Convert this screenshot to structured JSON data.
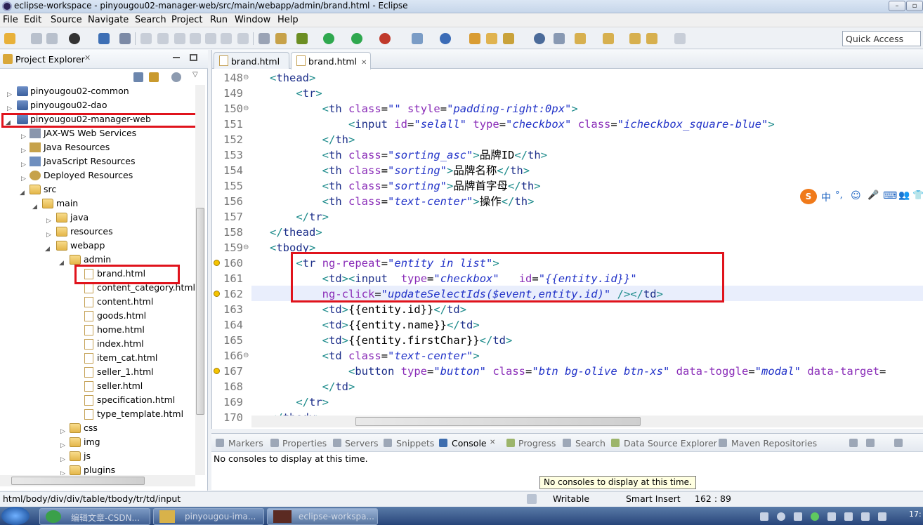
{
  "window": {
    "title": "eclipse-workspace - pinyougou02-manager-web/src/main/webapp/admin/brand.html - Eclipse",
    "buttons": [
      "–",
      "▫",
      "✕"
    ]
  },
  "menu": [
    "File",
    "Edit",
    "Source",
    "Navigate",
    "Search",
    "Project",
    "Run",
    "Window",
    "Help"
  ],
  "toolbar": {
    "quick_access": "Quick Access"
  },
  "explorer": {
    "title": "Project Explorer",
    "items": [
      {
        "label": "pinyougou02-common",
        "twisty": "▷"
      },
      {
        "label": "pinyougou02-dao",
        "twisty": "▷"
      },
      {
        "label": "pinyougou02-manager-web",
        "twisty": "◢"
      },
      {
        "label": "JAX-WS Web Services",
        "twisty": "▷"
      },
      {
        "label": "Java Resources",
        "twisty": "▷"
      },
      {
        "label": "JavaScript Resources",
        "twisty": "▷"
      },
      {
        "label": "Deployed Resources",
        "twisty": "▷"
      },
      {
        "label": "src",
        "twisty": "◢"
      },
      {
        "label": "main",
        "twisty": "◢"
      },
      {
        "label": "java",
        "twisty": "▷"
      },
      {
        "label": "resources",
        "twisty": "▷"
      },
      {
        "label": "webapp",
        "twisty": "◢"
      },
      {
        "label": "admin",
        "twisty": "◢"
      },
      {
        "label": "brand.html",
        "twisty": ""
      },
      {
        "label": "content_category.html",
        "twisty": ""
      },
      {
        "label": "content.html",
        "twisty": ""
      },
      {
        "label": "goods.html",
        "twisty": ""
      },
      {
        "label": "home.html",
        "twisty": ""
      },
      {
        "label": "index.html",
        "twisty": ""
      },
      {
        "label": "item_cat.html",
        "twisty": ""
      },
      {
        "label": "seller_1.html",
        "twisty": ""
      },
      {
        "label": "seller.html",
        "twisty": ""
      },
      {
        "label": "specification.html",
        "twisty": ""
      },
      {
        "label": "type_template.html",
        "twisty": ""
      },
      {
        "label": "css",
        "twisty": "▷"
      },
      {
        "label": "img",
        "twisty": "▷"
      },
      {
        "label": "js",
        "twisty": "▷"
      },
      {
        "label": "plugins",
        "twisty": "▷"
      }
    ]
  },
  "editor": {
    "tabs": [
      {
        "label": "brand.html"
      },
      {
        "label": "brand.html"
      }
    ],
    "lines": [
      {
        "n": "148",
        "code": "<thead>"
      },
      {
        "n": "149",
        "code": "    <tr>"
      },
      {
        "n": "150",
        "code": "        <th class=\"\" style=\"padding-right:0px\">"
      },
      {
        "n": "151",
        "code": "            <input id=\"selall\" type=\"checkbox\" class=\"icheckbox_square-blue\">"
      },
      {
        "n": "152",
        "code": "        </th>"
      },
      {
        "n": "153",
        "code": "        <th class=\"sorting_asc\">品牌ID</th>"
      },
      {
        "n": "154",
        "code": "        <th class=\"sorting\">品牌名称</th>"
      },
      {
        "n": "155",
        "code": "        <th class=\"sorting\">品牌首字母</th>"
      },
      {
        "n": "156",
        "code": "        <th class=\"text-center\">操作</th>"
      },
      {
        "n": "157",
        "code": "    </tr>"
      },
      {
        "n": "158",
        "code": "</thead>"
      },
      {
        "n": "159",
        "code": "<tbody>"
      },
      {
        "n": "160",
        "code": "    <tr ng-repeat=\"entity in list\">"
      },
      {
        "n": "161",
        "code": "        <td><input  type=\"checkbox\"   id=\"{{entity.id}}\""
      },
      {
        "n": "162",
        "code": "        ng-click=\"updateSelectIds($event,entity.id)\" /></td>"
      },
      {
        "n": "163",
        "code": "        <td>{{entity.id}}</td>"
      },
      {
        "n": "164",
        "code": "        <td>{{entity.name}}</td>"
      },
      {
        "n": "165",
        "code": "        <td>{{entity.firstChar}}</td>"
      },
      {
        "n": "166",
        "code": "        <td class=\"text-center\">"
      },
      {
        "n": "167",
        "code": "            <button type=\"button\" class=\"btn bg-olive btn-xs\" data-toggle=\"modal\" data-target="
      },
      {
        "n": "168",
        "code": "        </td>"
      },
      {
        "n": "169",
        "code": "    </tr>"
      },
      {
        "n": "170",
        "code": "</tbody>"
      }
    ]
  },
  "bottom_panel": {
    "tabs": [
      "Markers",
      "Properties",
      "Servers",
      "Snippets",
      "Console",
      "Progress",
      "Search",
      "Data Source Explorer",
      "Maven Repositories"
    ],
    "console_text": "No consoles to display at this time.",
    "tooltip": "No consoles to display at this time."
  },
  "statusbar": {
    "path": "html/body/div/div/table/tbody/tr/td/input",
    "writable": "Writable",
    "insert_mode": "Smart Insert",
    "position": "162 : 89"
  },
  "taskbar": {
    "items": [
      "编辑文章-CSDN...",
      "pinyougou-ima...",
      "eclipse-workspa..."
    ],
    "clock": "17:"
  },
  "ime": {
    "glyphs": [
      "中",
      "°,",
      "☺",
      "🎤",
      "⌨",
      "👥",
      "👕"
    ]
  },
  "colors": {
    "highlight": "#e0131c",
    "tag": "#1d2f8a",
    "attribute": "#8a2db8",
    "value": "#2233c8"
  }
}
